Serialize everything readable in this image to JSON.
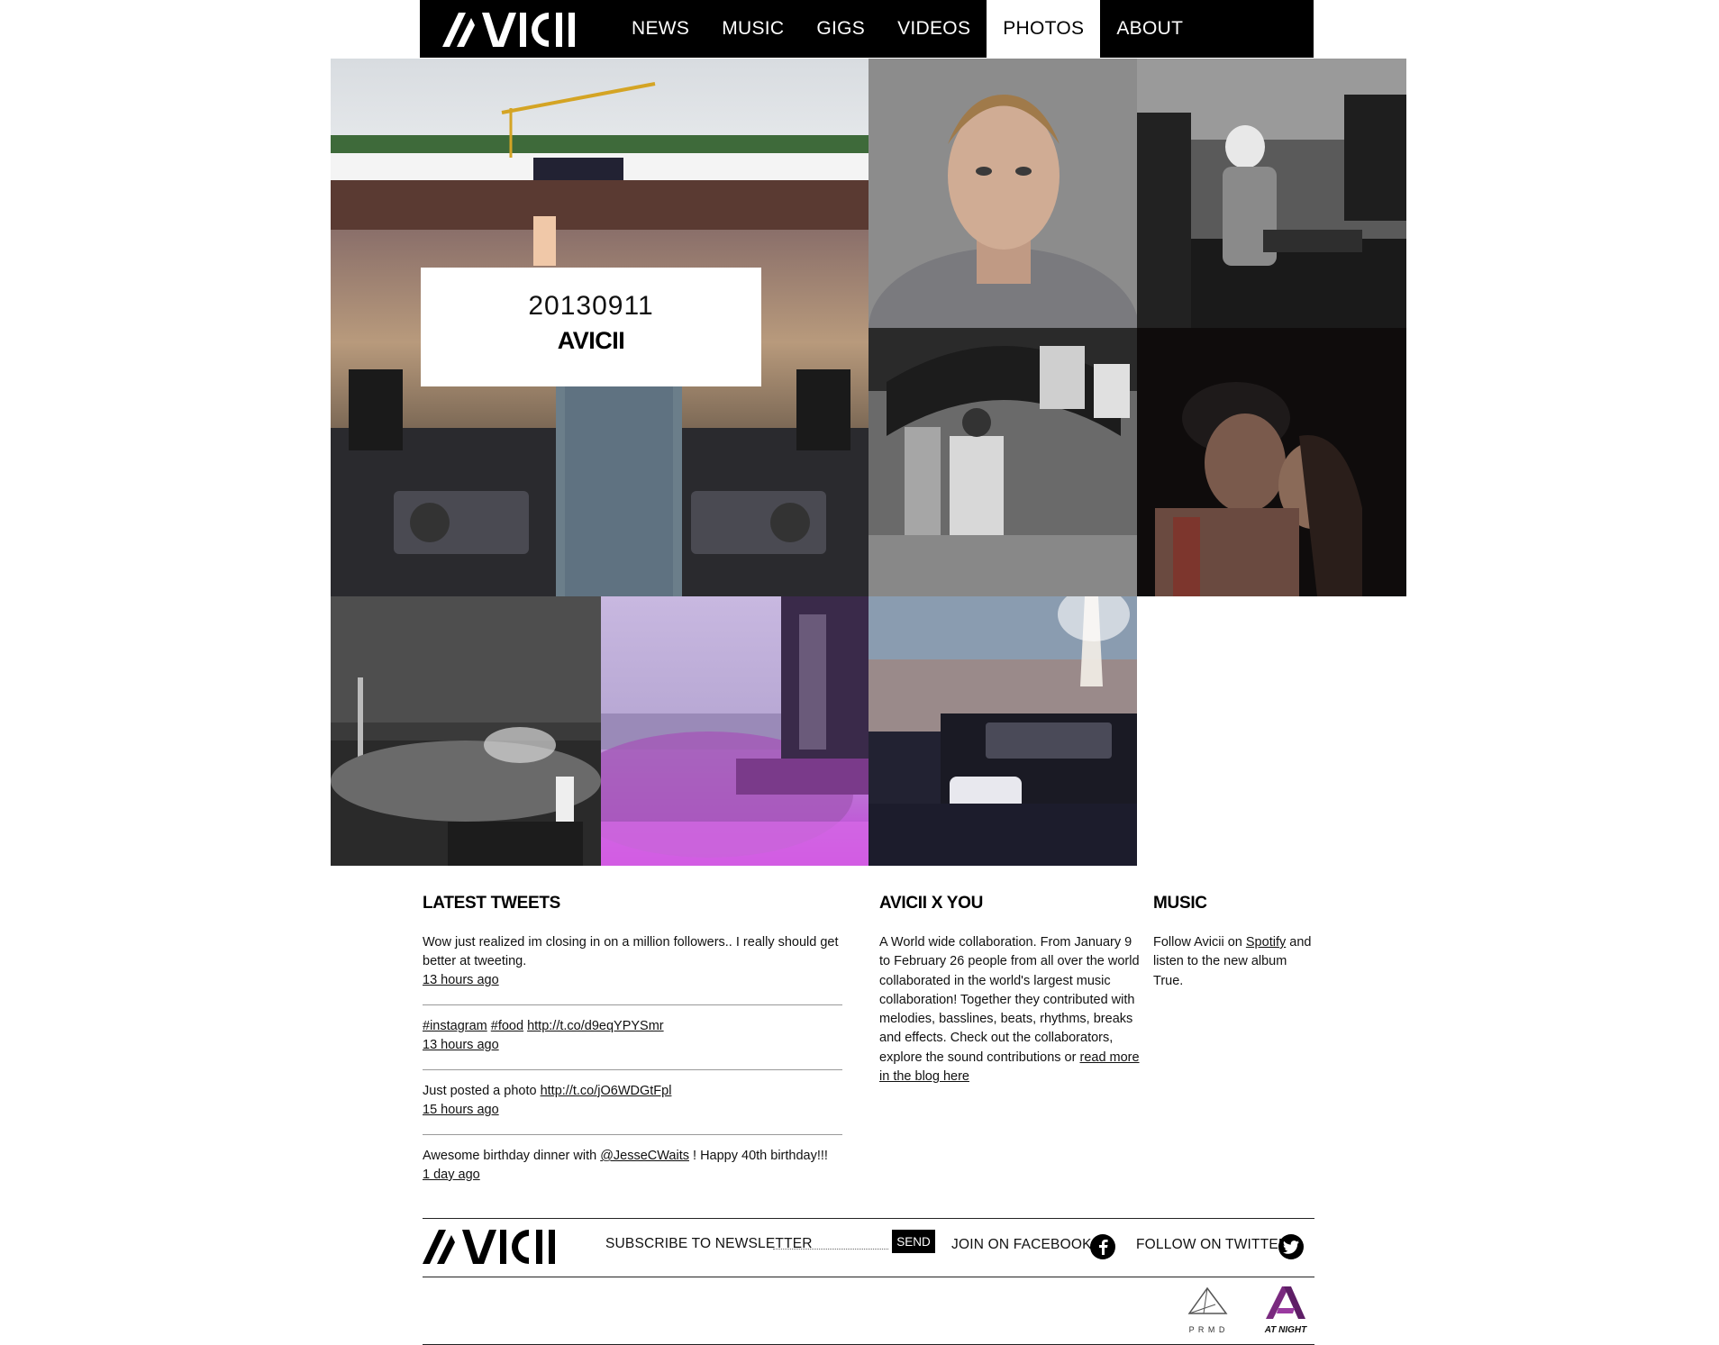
{
  "header": {
    "logo_alt": "AVICII",
    "nav": [
      {
        "label": "NEWS"
      },
      {
        "label": "MUSIC"
      },
      {
        "label": "GIGS"
      },
      {
        "label": "VIDEOS"
      },
      {
        "label": "PHOTOS",
        "active": true
      },
      {
        "label": "ABOUT"
      }
    ]
  },
  "feature": {
    "date": "20130911",
    "name": "AVICII"
  },
  "tweets": {
    "title": "LATEST TWEETS",
    "items": [
      {
        "pre": "Wow just realized im closing in on a million followers.. I really should get better at tweeting.",
        "time": "13 hours ago"
      },
      {
        "tag1": "#instagram",
        "tag2": "#food",
        "link": "http://t.co/d9eqYPYSmr",
        "time": "13 hours ago"
      },
      {
        "pre": "Just posted a photo ",
        "link": "http://t.co/jO6WDGtFpl",
        "time": "15 hours ago"
      },
      {
        "pre": "Awesome birthday dinner with ",
        "link": "@JesseCWaits",
        "post": " ! Happy 40th birthday!!!",
        "time": "1 day ago"
      }
    ]
  },
  "avicii_x_you": {
    "title": "AVICII X YOU",
    "text": "A World wide collaboration. From January 9 to February 26 people from all over the world collaborated in the world's largest music collaboration! Together they contributed with melodies, basslines, beats, rhythms, breaks and effects. Check out the collaborators, explore the sound contributions or ",
    "link": "read more in the blog here"
  },
  "music": {
    "title": "MUSIC",
    "pre": "Follow Avicii on ",
    "link": "Spotify",
    "post": " and listen to the new album True."
  },
  "footer": {
    "subscribe_label": "SUBSCRIBE TO NEWSLETTER",
    "send_label": "SEND",
    "facebook_label": "JOIN ON FACEBOOK",
    "twitter_label": "FOLLOW ON TWITTER",
    "prmd_label": "P R M D",
    "atnight_label": "AT NIGHT"
  },
  "colors": {
    "nav_bg": "#000000",
    "accent_purple": "#7a2a7f"
  }
}
